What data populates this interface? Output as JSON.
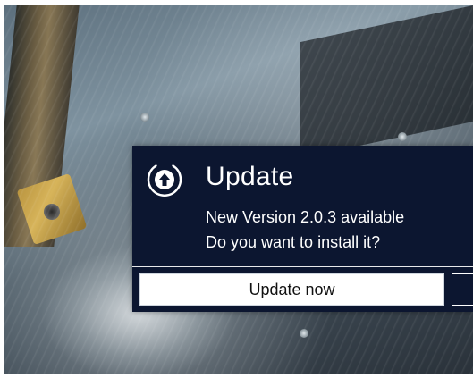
{
  "dialog": {
    "title": "Update",
    "line1": "New Version 2.0.3 available",
    "line2": "Do you want to install it?",
    "primary_button": "Update now",
    "icon": "upload-arrow-circle-icon"
  },
  "colors": {
    "dialog_background": "#0c1630",
    "text": "#ffffff",
    "button_background": "#ffffff",
    "button_text": "#111111"
  }
}
